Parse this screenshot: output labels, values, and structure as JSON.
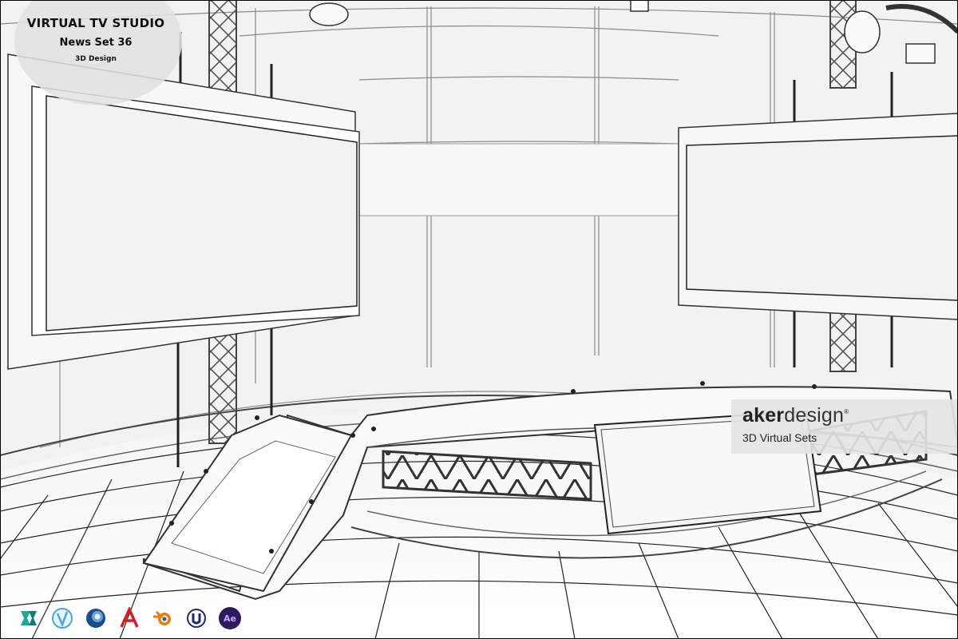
{
  "title": {
    "line1": "VIRTUAL TV STUDIO",
    "line2": "News Set 36",
    "line3": "3D Design"
  },
  "brand": {
    "name_bold": "aker",
    "name_light": "design",
    "registered": "®",
    "tagline": "3D Virtual Sets"
  },
  "software_icons": [
    {
      "name": "3ds-max-icon",
      "color": "#1aa89b"
    },
    {
      "name": "vue-icon",
      "color": "#4aa7d8"
    },
    {
      "name": "cinema4d-icon",
      "color": "#1b4d8c"
    },
    {
      "name": "autodesk-icon",
      "color": "#d11f26"
    },
    {
      "name": "blender-icon",
      "color": "#e87d0d"
    },
    {
      "name": "unreal-engine-icon",
      "color": "#1c2a6b"
    },
    {
      "name": "after-effects-icon",
      "color": "#2d1b5e",
      "label": "Ae"
    }
  ],
  "colors": {
    "wall": "#f3f3f3",
    "line": "#3a3a3a",
    "screen": "#f7f7f7",
    "truss": "#444444"
  }
}
